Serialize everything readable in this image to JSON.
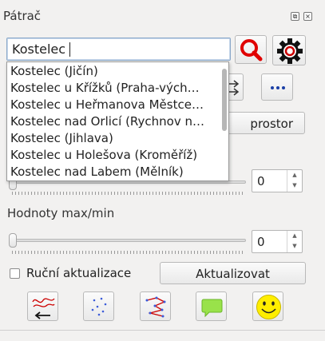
{
  "panel": {
    "title": "Pátrač"
  },
  "search": {
    "value": "Kostelec",
    "suggestions": [
      "Kostelec (Jičín)",
      "Kostelec u Křížků (Praha-vých…",
      "Kostelec u Heřmanova Městce…",
      "Kostelec nad Orlicí (Rychnov n…",
      "Kostelec (Jihlava)",
      "Kostelec u Holešova (Kroměříž)",
      "Kostelec nad Labem (Mělník)"
    ]
  },
  "buttons": {
    "prostor_label": "prostor",
    "update_label": "Aktualizovat"
  },
  "sliders": {
    "first": {
      "value": "0"
    },
    "maxmin": {
      "label": "Hodnoty max/min",
      "value": "0"
    }
  },
  "manual_update": {
    "label": "Ruční aktualizace",
    "checked": false
  },
  "colors": {
    "search_icon": "#e00000",
    "gear_icon": "#cc0000",
    "smiley": "#ffee00",
    "comment": "#99e24a"
  },
  "icons": {
    "search": "magnifier-icon",
    "settings": "gear-icon",
    "more": "ellipsis-icon",
    "tools": [
      "route-back-icon",
      "points-icon",
      "polyline-icon",
      "comment-icon",
      "smiley-icon"
    ]
  }
}
